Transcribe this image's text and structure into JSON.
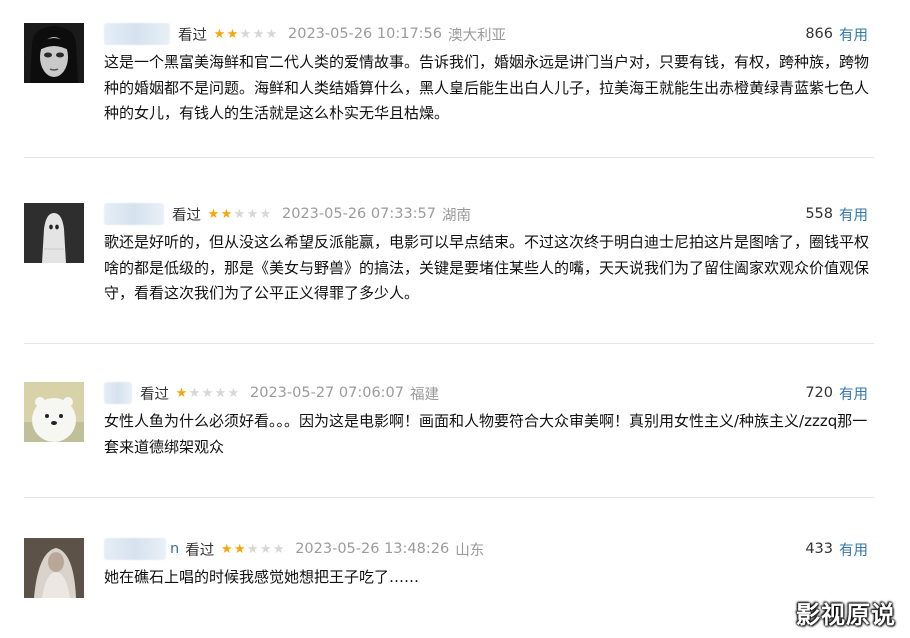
{
  "comments": [
    {
      "name_tail": "",
      "watched": "看过",
      "rating": 2,
      "time": "2023-05-26 10:17:56",
      "location": "澳大利亚",
      "votes": "866",
      "useful": "有用",
      "content": "这是一个黑富美海鲜和官二代人类的爱情故事。告诉我们，婚姻永远是讲门当户对，只要有钱，有权，跨种族，跨物种的婚姻都不是问题。海鲜和人类结婚算什么，黑人皇后能生出白人儿子，拉美海王就能生出赤橙黄绿青蓝紫七色人种的女儿，有钱人的生活就是这么朴实无华且枯燥。"
    },
    {
      "name_tail": "",
      "watched": "看过",
      "rating": 2,
      "time": "2023-05-26 07:33:57",
      "location": "湖南",
      "votes": "558",
      "useful": "有用",
      "content": "歌还是好听的，但从没这么希望反派能赢，电影可以早点结束。不过这次终于明白迪士尼拍这片是图啥了，圈钱平权啥的都是低级的，那是《美女与野兽》的搞法，关键是要堵住某些人的嘴，天天说我们为了留住阖家欢观众价值观保守，看看这次我们为了公平正义得罪了多少人。"
    },
    {
      "name_tail": "",
      "watched": "看过",
      "rating": 1,
      "time": "2023-05-27 07:06:07",
      "location": "福建",
      "votes": "720",
      "useful": "有用",
      "content": "女性人鱼为什么必须好看。。。因为这是电影啊！画面和人物要符合大众审美啊！真别用女性主义/种族主义/zzzq那一套来道德绑架观众"
    },
    {
      "name_tail": "n",
      "watched": "看过",
      "rating": 2,
      "time": "2023-05-26 13:48:26",
      "location": "山东",
      "votes": "433",
      "useful": "有用",
      "content": "她在礁石上唱的时候我感觉她想把王子吃了……"
    }
  ],
  "watermark": "影视原说",
  "colors": {
    "star_on": "#f6a60a",
    "star_off": "#d7d7d7",
    "useful_link": "#3377aa",
    "meta_gray": "#9b9b9b"
  },
  "avatars": [
    "dark-haired-face-avatar",
    "ghost-sheet-avatar",
    "polar-bear-avatar",
    "veiled-figure-avatar"
  ]
}
